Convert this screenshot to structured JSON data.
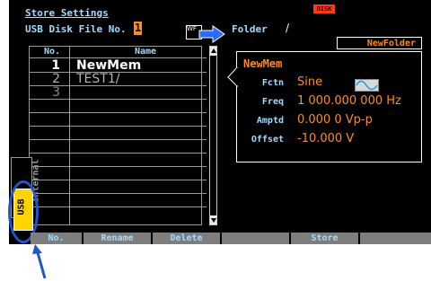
{
  "header": {
    "title": "Store Settings",
    "usb_disk_label": "USB Disk File No.",
    "usb_disk_number": "1",
    "disk_badge": "DISK",
    "wf_icon_text": "WF",
    "folder_label": "Folder",
    "folder_path": "/",
    "new_folder_button": "NewFolder"
  },
  "file_table": {
    "columns": [
      "No.",
      "Name"
    ],
    "rows": [
      {
        "no": "1",
        "name": "NewMem"
      },
      {
        "no": "2",
        "name": "TEST1/"
      },
      {
        "no": "3",
        "name": ""
      }
    ]
  },
  "preview": {
    "name": "NewMem",
    "fields": [
      {
        "label": "Fctn",
        "value": "Sine"
      },
      {
        "label": "Freq",
        "value": "1 000.000 000 Hz"
      },
      {
        "label": "Amptd",
        "value": "0.000 0 Vp-p"
      },
      {
        "label": "Offset",
        "value": "-10.000 V"
      }
    ],
    "waveform_icon": "sine-wave-icon"
  },
  "side_tabs": {
    "internal": "Internal",
    "usb": "USB"
  },
  "softkeys": [
    "No.",
    "Rename",
    "Delete",
    "",
    "Store",
    ""
  ],
  "colors": {
    "accent_text": "#9fdcff",
    "value_text": "#ff8c1a",
    "usb_tab": "#ffd400",
    "highlight": "#2255cc"
  }
}
